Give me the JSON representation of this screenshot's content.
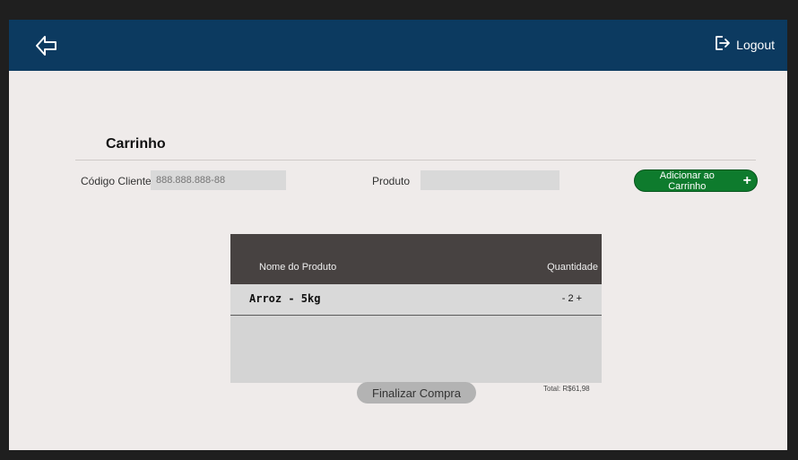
{
  "header": {
    "logout_label": "Logout"
  },
  "page": {
    "title": "Carrinho"
  },
  "form": {
    "cliente_label": "Código Cliente",
    "cliente_placeholder": "888.888.888-88",
    "produto_label": "Produto",
    "produto_placeholder": "",
    "add_button_label": "Adicionar ao Carrinho",
    "add_button_icon": "+"
  },
  "table": {
    "headers": [
      "Nome do Produto",
      "Quantidade"
    ],
    "rows": [
      {
        "name": "Arroz - 5kg",
        "minus": "-",
        "quantity": "2",
        "plus": "+"
      }
    ]
  },
  "footer": {
    "finalize_label": "Finalizar Compra",
    "total": "Total: R$61,98"
  },
  "colors": {
    "header_bg": "#0c3a60",
    "add_button": "#0e7b2d",
    "table_header": "#474241"
  }
}
